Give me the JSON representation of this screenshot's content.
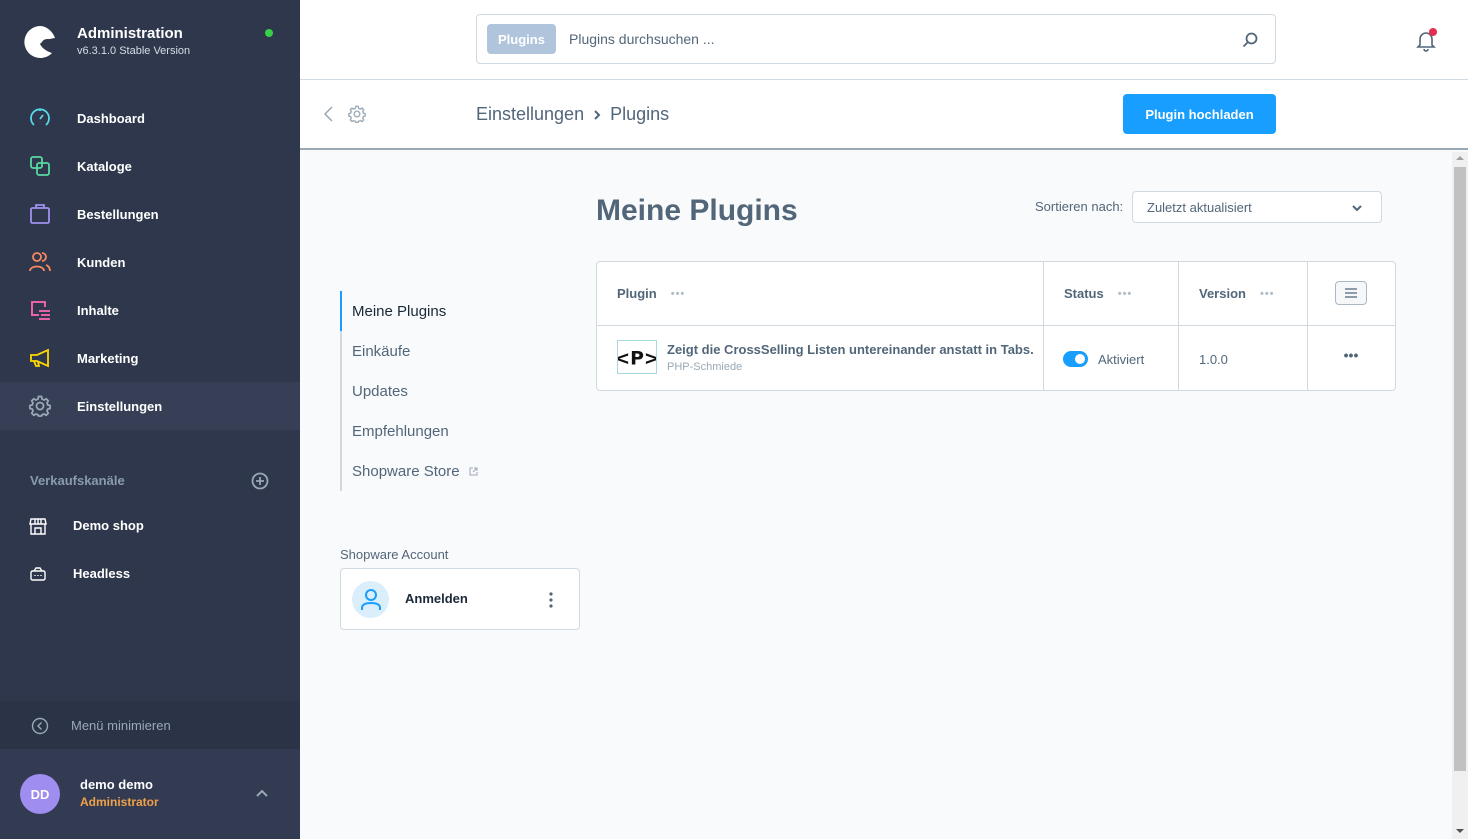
{
  "brand": {
    "title": "Administration",
    "version": "v6.3.1.0 Stable Version",
    "status_color": "#37d046"
  },
  "sidebar": {
    "items": [
      {
        "label": "Dashboard",
        "icon": "dashboard-icon",
        "color": "#57d9e8"
      },
      {
        "label": "Kataloge",
        "icon": "catalog-icon",
        "color": "#57d9a3"
      },
      {
        "label": "Bestellungen",
        "icon": "orders-icon",
        "color": "#a092f0"
      },
      {
        "label": "Kunden",
        "icon": "customers-icon",
        "color": "#f88962"
      },
      {
        "label": "Inhalte",
        "icon": "content-icon",
        "color": "#ff68b4"
      },
      {
        "label": "Marketing",
        "icon": "marketing-icon",
        "color": "#ffd700"
      },
      {
        "label": "Einstellungen",
        "icon": "settings-icon",
        "color": "#9aa8b5",
        "active": true
      }
    ],
    "sales_channels_title": "Verkaufskanäle",
    "sales_channels": [
      {
        "label": "Demo shop",
        "icon": "storefront-icon"
      },
      {
        "label": "Headless",
        "icon": "basket-icon"
      }
    ],
    "minimize_label": "Menü minimieren"
  },
  "user": {
    "initials": "DD",
    "name": "demo demo",
    "role": "Administrator"
  },
  "search": {
    "tag": "Plugins",
    "placeholder": "Plugins durchsuchen ..."
  },
  "smartbar": {
    "breadcrumb": [
      "Einstellungen",
      "Plugins"
    ],
    "upload_label": "Plugin hochladen"
  },
  "subnav": {
    "items": [
      {
        "label": "Meine Plugins",
        "active": true
      },
      {
        "label": "Einkäufe"
      },
      {
        "label": "Updates"
      },
      {
        "label": "Empfehlungen"
      },
      {
        "label": "Shopware Store",
        "external": true
      }
    ]
  },
  "account": {
    "title": "Shopware Account",
    "login_label": "Anmelden"
  },
  "main": {
    "title": "Meine Plugins",
    "sort_label": "Sortieren nach:",
    "sort_value": "Zuletzt aktualisiert"
  },
  "table": {
    "columns": [
      "Plugin",
      "Status",
      "Version"
    ],
    "rows": [
      {
        "name": "Zeigt die CrossSelling Listen untereinander anstatt in Tabs.",
        "author": "PHP-Schmiede",
        "icon_text": "<P>",
        "active": true,
        "status": "Aktiviert",
        "version": "1.0.0"
      }
    ]
  }
}
